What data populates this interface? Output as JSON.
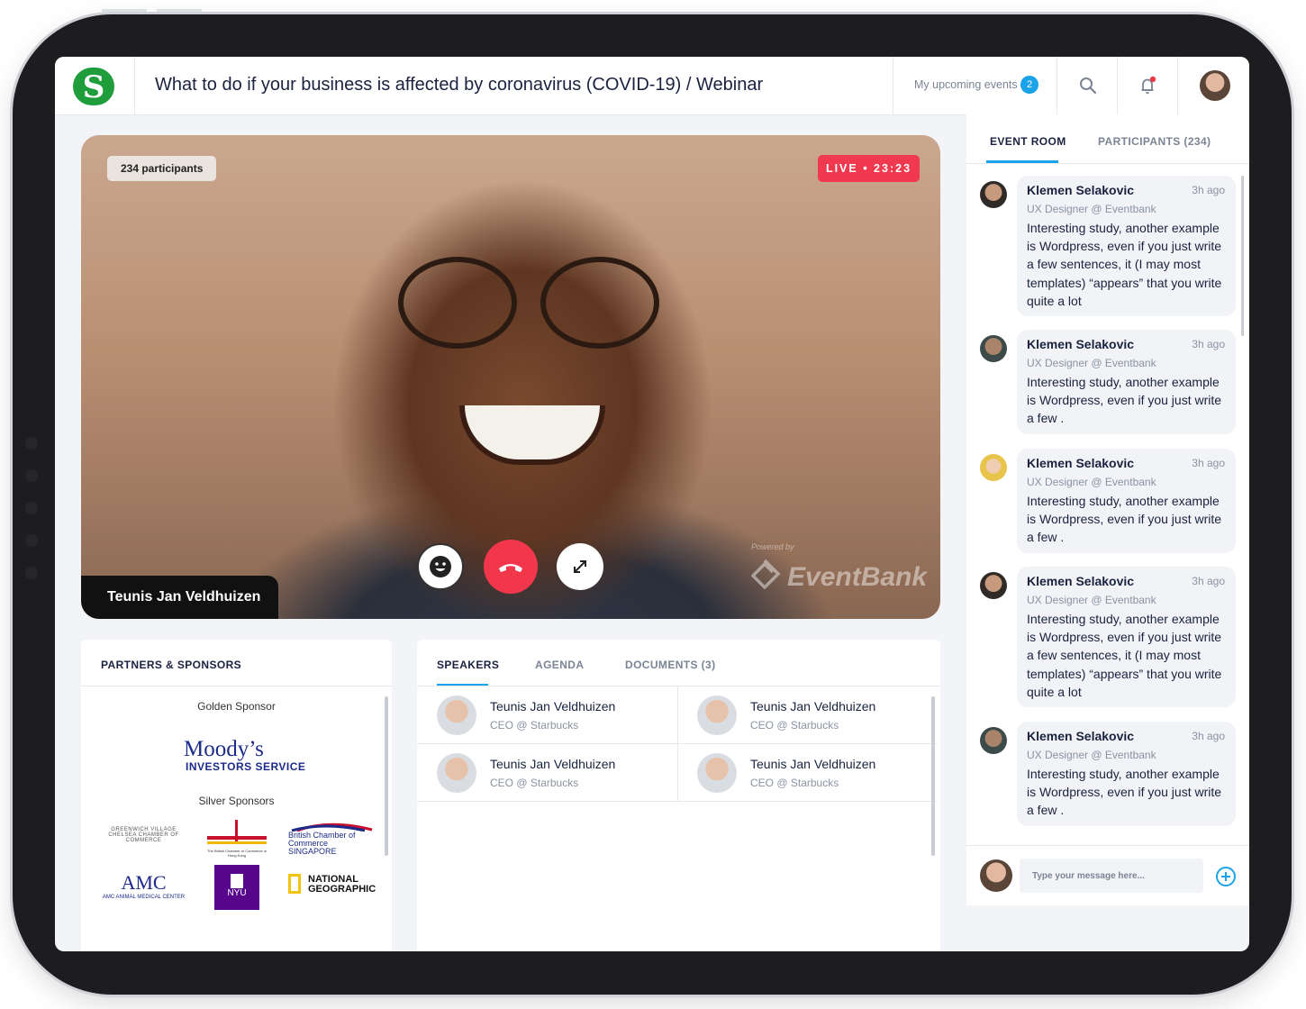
{
  "header": {
    "logo_letter": "S",
    "title": "What to do if your business is affected by coronavirus (COVID-19) / Webinar",
    "upcoming_label": "My upcoming events",
    "upcoming_count": "2"
  },
  "video": {
    "participants": "234 participants",
    "live": "LIVE • 23:23",
    "speaker": "Teunis Jan Veldhuizen",
    "powered_by": "Powered by",
    "brand": "EventBank"
  },
  "sponsors": {
    "title": "PARTNERS & SPONSORS",
    "golden_label": "Golden Sponsor",
    "moodys_line1": "Moody’s",
    "moodys_line2": "INVESTORS SERVICE",
    "silver_label": "Silver Sponsors",
    "logos": [
      "GREENWICH VILLAGE CHELSEA CHAMBER OF COMMERCE",
      "The British Chamber of Commerce in Hong Kong",
      "British Chamber of Commerce SINGAPORE",
      "AMC ANIMAL MEDICAL CENTER",
      "NYU",
      "NATIONAL GEOGRAPHIC"
    ]
  },
  "speakers_panel": {
    "tabs": [
      "SPEAKERS",
      "AGENDA",
      "DOCUMENTS (3)"
    ],
    "speakers": [
      {
        "name": "Teunis Jan Veldhuizen",
        "role": "CEO @ Starbucks"
      },
      {
        "name": "Teunis Jan Veldhuizen",
        "role": "CEO @ Starbucks"
      },
      {
        "name": "Teunis Jan Veldhuizen",
        "role": "CEO @ Starbucks"
      },
      {
        "name": "Teunis Jan Veldhuizen",
        "role": "CEO @ Starbucks"
      }
    ]
  },
  "event_room": {
    "tabs": [
      "EVENT ROOM",
      "PARTICIPANTS (234)"
    ],
    "messages": [
      {
        "name": "Klemen Selakovic",
        "time": "3h ago",
        "role": "UX Designer @ Eventbank",
        "text": "Interesting study, another example is Wordpress, even if you just write a few sentences, it (I may most templates) “appears” that you write quite a lot"
      },
      {
        "name": "Klemen Selakovic",
        "time": "3h ago",
        "role": "UX Designer @ Eventbank",
        "text": "Interesting study, another example is Wordpress, even if you just write a few ."
      },
      {
        "name": "Klemen Selakovic",
        "time": "3h ago",
        "role": "UX Designer @ Eventbank",
        "text": "Interesting study, another example is Wordpress, even if you just write a few ."
      },
      {
        "name": "Klemen Selakovic",
        "time": "3h ago",
        "role": "UX Designer @ Eventbank",
        "text": "Interesting study, another example is Wordpress, even if you just write a few sentences, it (I may most templates) “appears” that you write quite a lot"
      },
      {
        "name": "Klemen Selakovic",
        "time": "3h ago",
        "role": "UX Designer @ Eventbank",
        "text": "Interesting study, another example is Wordpress, even if you just write a few ."
      }
    ],
    "composer_placeholder": "Type your message here..."
  },
  "colors": {
    "accent": "#1aa3e8",
    "live": "#f0384f",
    "brand": "#1e9d3a"
  }
}
